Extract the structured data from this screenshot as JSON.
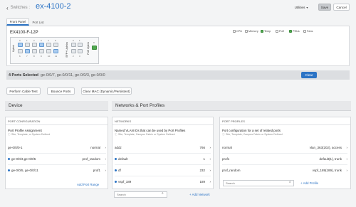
{
  "header": {
    "back_label": "Switches :",
    "switch_name": "ex-4100-2",
    "utilities_label": "Utilities",
    "save_label": "Save",
    "cancel_label": "Cancel"
  },
  "tabs": [
    {
      "label": "Front Panel"
    },
    {
      "label": "Port List"
    }
  ],
  "panel": {
    "model": "EX4100-F-12P",
    "legend": [
      "CPU",
      "Memory",
      "Temp",
      "PoE",
      "PSUs",
      "Fans"
    ],
    "group_labels": [
      "Uplink",
      "SFP+ Uplinks",
      "PoE Uplink"
    ],
    "port_numbers_top": [
      "0",
      "1",
      "2",
      "3",
      "4",
      "5"
    ],
    "port_numbers_bottom": [
      "6",
      "7",
      "8",
      "9",
      "10",
      "11"
    ],
    "uplink_numbers": [
      "0",
      "1",
      "2",
      "3"
    ],
    "poe_uplink_number": "0"
  },
  "selection": {
    "title": "4 Ports Selected",
    "ports": "ge-0/0/7, ge-0/0/11, ge-0/0/3, ge-0/0/0",
    "clear_label": "Clear"
  },
  "actions": {
    "cable_test": "Perform Cable Test",
    "bounce": "Bounce Ports",
    "clear_mac": "Clear MAC (Dynamic/Persistent)"
  },
  "device_section": {
    "title": "Device"
  },
  "networks_section": {
    "title": "Networks & Port Profiles"
  },
  "port_config": {
    "header": "PORT CONFIGURATION",
    "title": "Port Profile Assignment",
    "subtitle": "Site, Template, or System Defined",
    "rows": [
      {
        "ports": "ge-0/0/0-1",
        "profile": "normal"
      },
      {
        "ports": "ge-0/0/3,ge-0/0/5",
        "profile": "prof_random"
      },
      {
        "ports": "ge-0/0/5, ge-0/0/11",
        "profile": "prof1"
      }
    ],
    "add_label": "Add Port Range"
  },
  "networks": {
    "header": "NETWORKS",
    "title": "Named VLAN IDs that can be used by Port Profiles",
    "subtitle": "Site, Template, Campus Fabric or System Defined",
    "rows": [
      {
        "name": "addz",
        "value": "766"
      },
      {
        "name": "default",
        "value": "1"
      },
      {
        "name": "df",
        "value": "232"
      },
      {
        "name": "vspf_189",
        "value": "189"
      }
    ],
    "search_placeholder": "Search",
    "add_label": "Add Network"
  },
  "port_profiles": {
    "header": "PORT PROFILES",
    "title": "Port configuration for a set of related ports",
    "subtitle": "Site, Template, Campus Fabric or System Defined",
    "rows": [
      {
        "name": "normal",
        "value": "vlan_363(202), access"
      },
      {
        "name": "prof1",
        "value": "default(1), trunk"
      },
      {
        "name": "prof_random",
        "value": "vspf_189(189), trunk"
      }
    ],
    "search_placeholder": "Search",
    "add_label": "Add Profile"
  },
  "colors": {
    "accent": "#2b73c5",
    "selected_port": "#a9cbee",
    "port_up": "#4fa84f",
    "selection_bar": "#dcdee1"
  }
}
